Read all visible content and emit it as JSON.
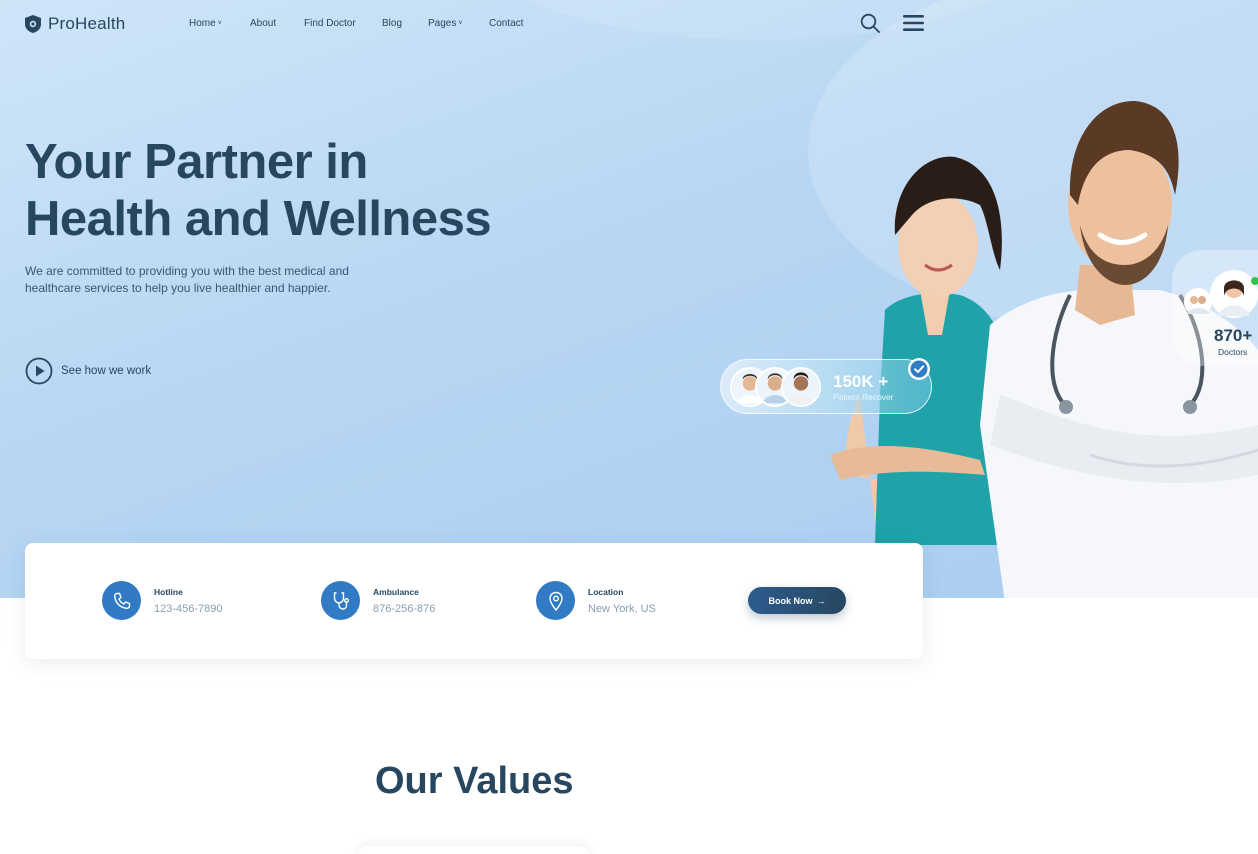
{
  "brand": {
    "name": "ProHealth"
  },
  "nav": [
    {
      "label": "Home",
      "dropdown": true
    },
    {
      "label": "About",
      "dropdown": false
    },
    {
      "label": "Find Doctor",
      "dropdown": false
    },
    {
      "label": "Blog",
      "dropdown": false
    },
    {
      "label": "Pages",
      "dropdown": true
    },
    {
      "label": "Contact",
      "dropdown": false
    }
  ],
  "hero": {
    "title_line1": "Your Partner in",
    "title_line2": "Health and Wellness",
    "subtitle": "We are committed to providing you with the best medical and healthcare services to help you live healthier and happier.",
    "cta": "See how we work"
  },
  "stats": {
    "patients": {
      "value": "150K +",
      "caption": "Patient Recover"
    },
    "doctors": {
      "value": "870+",
      "caption": "Doctors"
    }
  },
  "contact": {
    "hotline": {
      "label": "Hotline",
      "value": "123-456-7890",
      "icon": "phone-icon"
    },
    "ambulance": {
      "label": "Ambulance",
      "value": "876-256-876",
      "icon": "stethoscope-icon"
    },
    "location": {
      "label": "Location",
      "value": "New York, US",
      "icon": "location-pin-icon"
    },
    "book_label": "Book Now"
  },
  "values": {
    "title": "Our Values"
  },
  "colors": {
    "primary": "#274760",
    "accent": "#307bc4",
    "hero_bg": "#b7d6f3"
  }
}
